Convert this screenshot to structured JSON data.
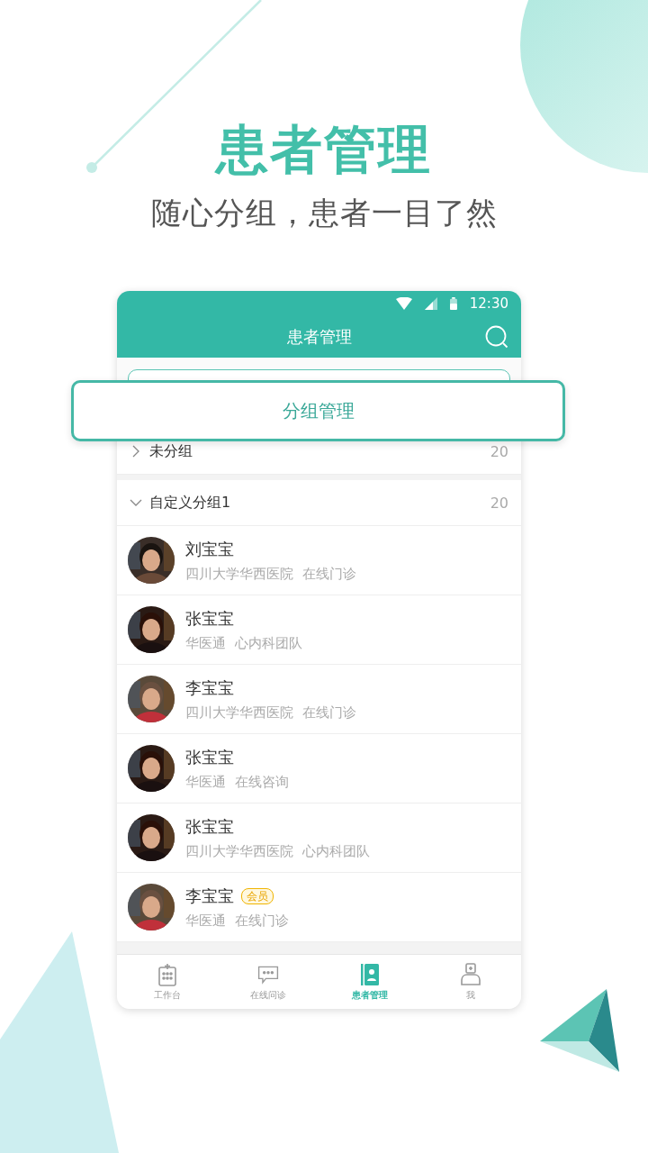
{
  "headline": "患者管理",
  "subtitle": "随心分组，患者一目了然",
  "phone": {
    "status_bar": {
      "time": "12:30"
    },
    "title": "患者管理",
    "popup_button": "分组管理",
    "groups": [
      {
        "name": "未分组",
        "count": "20",
        "expanded": false
      },
      {
        "name": "自定义分组1",
        "count": "20",
        "expanded": true,
        "children": [
          {
            "name": "刘宝宝",
            "hospital": "四川大学华西医院",
            "service": "在线门诊"
          },
          {
            "name": "张宝宝",
            "hospital": "华医通",
            "service": "心内科团队"
          },
          {
            "name": "李宝宝",
            "hospital": "四川大学华西医院",
            "service": "在线门诊"
          },
          {
            "name": "张宝宝",
            "hospital": "华医通",
            "service": "在线咨询"
          },
          {
            "name": "张宝宝",
            "hospital": "四川大学华西医院",
            "service": "心内科团队"
          },
          {
            "name": "李宝宝",
            "badge": "会员",
            "hospital": "华医通",
            "service": "在线门诊"
          }
        ]
      }
    ],
    "tabs": [
      {
        "label": "工作台",
        "selected": false
      },
      {
        "label": "在线问诊",
        "selected": false
      },
      {
        "label": "患者管理",
        "selected": true
      },
      {
        "label": "我",
        "selected": false
      }
    ]
  }
}
